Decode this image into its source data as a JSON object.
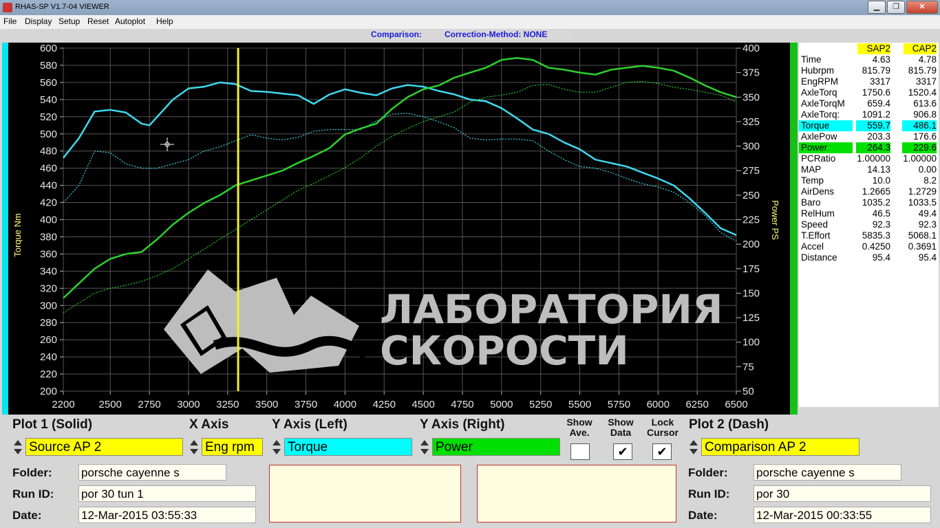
{
  "window": {
    "title": "RHAS-SP V1.7-04  VIEWER",
    "minimize": "▁",
    "maximize": "❐",
    "close": "✕"
  },
  "menu": {
    "file": "File",
    "display": "Display",
    "setup": "Setup",
    "reset": "Reset",
    "autoplot": "Autoplot",
    "help": "Help"
  },
  "header": {
    "comparison": "Comparison:",
    "correction": "Correction-Method: NONE"
  },
  "axes": {
    "left_label": "Torque Nm",
    "right_label": "Power PS",
    "x_ticks": [
      "2200",
      "2500",
      "2750",
      "3000",
      "3250",
      "3500",
      "3750",
      "4000",
      "4250",
      "4500",
      "4750",
      "5000",
      "5250",
      "5500",
      "5750",
      "6000",
      "6250",
      "6500"
    ],
    "left_ticks": [
      "600",
      "580",
      "560",
      "540",
      "520",
      "500",
      "480",
      "460",
      "440",
      "420",
      "400",
      "380",
      "360",
      "340",
      "320",
      "300",
      "280",
      "260",
      "240",
      "220",
      "200"
    ],
    "right_ticks": [
      "400",
      "375",
      "350",
      "325",
      "300",
      "275",
      "250",
      "225",
      "200",
      "175",
      "150",
      "125",
      "100",
      "75",
      "50"
    ]
  },
  "watermark": {
    "line1": "ЛАБОРАТОРИЯ",
    "line2": "СКОРОСТИ"
  },
  "colors": {
    "torque": "#3fd9ee",
    "power": "#2ed02e",
    "cursor": "#f2f22a",
    "source_bg": "#ffff00",
    "torque_bg": "#00ffff",
    "power_bg": "#00e000"
  },
  "chart_data": {
    "type": "line",
    "x_range": [
      2200,
      6500
    ],
    "ylim_left": [
      200,
      600
    ],
    "ylim_right": [
      50,
      400
    ],
    "cursor_x": 3317,
    "series": [
      {
        "name": "Torque",
        "axis": "left",
        "style": "solid",
        "x": [
          2200,
          2300,
          2400,
          2500,
          2600,
          2700,
          2750,
          2900,
          3000,
          3100,
          3200,
          3300,
          3400,
          3500,
          3600,
          3700,
          3800,
          3900,
          4000,
          4100,
          4200,
          4300,
          4400,
          4500,
          4600,
          4700,
          4800,
          4900,
          5000,
          5100,
          5200,
          5300,
          5400,
          5500,
          5600,
          5700,
          5800,
          5900,
          6000,
          6100,
          6200,
          6300,
          6400,
          6500
        ],
        "y": [
          472,
          495,
          526,
          528,
          525,
          512,
          510,
          540,
          553,
          555,
          560,
          558,
          550,
          549,
          547,
          545,
          535,
          546,
          552,
          548,
          545,
          553,
          557,
          555,
          550,
          546,
          540,
          538,
          530,
          518,
          505,
          500,
          490,
          482,
          470,
          466,
          462,
          455,
          448,
          440,
          425,
          408,
          390,
          382
        ]
      },
      {
        "name": "Torque (comparison)",
        "axis": "left",
        "style": "dash",
        "x": [
          2200,
          2300,
          2400,
          2500,
          2600,
          2700,
          2800,
          2900,
          3000,
          3100,
          3200,
          3300,
          3400,
          3500,
          3600,
          3700,
          3800,
          3900,
          4000,
          4100,
          4200,
          4300,
          4400,
          4500,
          4600,
          4700,
          4800,
          4900,
          5000,
          5100,
          5200,
          5300,
          5400,
          5500,
          5600,
          5700,
          5800,
          5900,
          6000,
          6100,
          6200,
          6300,
          6400,
          6500
        ],
        "y": [
          420,
          440,
          480,
          478,
          465,
          460,
          460,
          465,
          470,
          480,
          485,
          492,
          499,
          495,
          493,
          496,
          503,
          505,
          505,
          505,
          515,
          523,
          524,
          520,
          514,
          507,
          495,
          493,
          494,
          494,
          492,
          480,
          470,
          462,
          460,
          455,
          448,
          442,
          438,
          432,
          420,
          405,
          385,
          375
        ]
      },
      {
        "name": "Power",
        "axis": "right",
        "style": "solid",
        "x": [
          2200,
          2300,
          2400,
          2500,
          2600,
          2700,
          2800,
          2900,
          3000,
          3100,
          3200,
          3300,
          3400,
          3500,
          3600,
          3700,
          3800,
          3900,
          4000,
          4100,
          4200,
          4300,
          4400,
          4500,
          4600,
          4700,
          4800,
          4900,
          5000,
          5100,
          5200,
          5300,
          5400,
          5500,
          5600,
          5700,
          5800,
          5900,
          6000,
          6100,
          6200,
          6300,
          6400,
          6500
        ],
        "y": [
          145,
          160,
          175,
          185,
          190,
          192,
          205,
          220,
          232,
          242,
          250,
          260,
          265,
          270,
          275,
          283,
          290,
          298,
          312,
          318,
          323,
          338,
          350,
          358,
          362,
          370,
          375,
          380,
          388,
          390,
          388,
          380,
          378,
          375,
          373,
          378,
          380,
          382,
          380,
          377,
          370,
          362,
          355,
          350
        ]
      },
      {
        "name": "Power (comparison)",
        "axis": "right",
        "style": "dash",
        "x": [
          2200,
          2300,
          2400,
          2500,
          2600,
          2700,
          2800,
          2900,
          3000,
          3100,
          3200,
          3300,
          3400,
          3500,
          3600,
          3700,
          3800,
          3900,
          4000,
          4100,
          4200,
          4300,
          4400,
          4500,
          4600,
          4700,
          4800,
          4900,
          5000,
          5100,
          5200,
          5300,
          5400,
          5500,
          5600,
          5700,
          5800,
          5900,
          6000,
          6100,
          6200,
          6300,
          6400,
          6500
        ],
        "y": [
          130,
          140,
          150,
          155,
          158,
          162,
          168,
          175,
          185,
          195,
          205,
          215,
          225,
          235,
          245,
          255,
          262,
          270,
          278,
          288,
          300,
          310,
          318,
          325,
          330,
          335,
          345,
          350,
          352,
          355,
          362,
          363,
          358,
          355,
          355,
          360,
          365,
          366,
          364,
          360,
          358,
          355,
          352,
          345
        ]
      }
    ]
  },
  "table": {
    "col1": "SAP2",
    "col2": "CAP2",
    "rows": [
      {
        "label": "Time",
        "v1": "4.63",
        "v2": "4.78"
      },
      {
        "label": "Hubrpm",
        "v1": "815.79",
        "v2": "815.79"
      },
      {
        "label": "EngRPM",
        "v1": "3317",
        "v2": "3317"
      },
      {
        "label": "AxleTorq",
        "v1": "1750.6",
        "v2": "1520.4"
      },
      {
        "label": "AxleTorqM",
        "v1": "659.4",
        "v2": "613.6"
      },
      {
        "label": "AxleTorq:",
        "v1": "1091.2",
        "v2": "906.8"
      },
      {
        "label": "Torque",
        "v1": "559.7",
        "v2": "486.1"
      },
      {
        "label": "AxlePow",
        "v1": "203.3",
        "v2": "176.6"
      },
      {
        "label": "Power",
        "v1": "264.3",
        "v2": "229.6"
      },
      {
        "label": "PCRatio",
        "v1": "1.00000",
        "v2": "1.00000"
      },
      {
        "label": "MAP",
        "v1": "14.13",
        "v2": "0.00"
      },
      {
        "label": "Temp",
        "v1": "10.0",
        "v2": "8.2"
      },
      {
        "label": "AirDens",
        "v1": "1.2665",
        "v2": "1.2729"
      },
      {
        "label": "Baro",
        "v1": "1035.2",
        "v2": "1033.5"
      },
      {
        "label": "RelHum",
        "v1": "46.5",
        "v2": "49.4"
      },
      {
        "label": "Speed",
        "v1": "92.3",
        "v2": "92.3"
      },
      {
        "label": "T.Effort",
        "v1": "5835.3",
        "v2": "5068.1"
      },
      {
        "label": "Accel",
        "v1": "0.4250",
        "v2": "0.3691"
      },
      {
        "label": "Distance",
        "v1": "95.4",
        "v2": "95.4"
      }
    ]
  },
  "controls": {
    "plot1_label": "Plot 1 (Solid)",
    "xaxis_label": "X Axis",
    "yleft_label": "Y Axis (Left)",
    "yright_label": "Y Axis (Right)",
    "show_ave_1": "Show",
    "show_ave_2": "Ave.",
    "show_data_1": "Show",
    "show_data_2": "Data",
    "lock_cursor_1": "Lock",
    "lock_cursor_2": "Cursor",
    "plot2_label": "Plot 2 (Dash)",
    "plot1_value": "Source AP 2",
    "xaxis_value": "Eng rpm",
    "yleft_value": "Torque",
    "yright_value": "Power",
    "plot2_value": "Comparison AP 2",
    "show_ave_checked": "",
    "show_data_checked": "✔",
    "lock_cursor_checked": "✔"
  },
  "run1": {
    "folder_label": "Folder:",
    "folder": "porsche cayenne s",
    "runid_label": "Run ID:",
    "runid": "por 30 tun 1",
    "date_label": "Date:",
    "date": "12-Mar-2015  03:55:33"
  },
  "run2": {
    "folder_label": "Folder:",
    "folder": "porsche cayenne s",
    "runid_label": "Run ID:",
    "runid": "por 30",
    "date_label": "Date:",
    "date": "12-Mar-2015  00:33:55"
  }
}
